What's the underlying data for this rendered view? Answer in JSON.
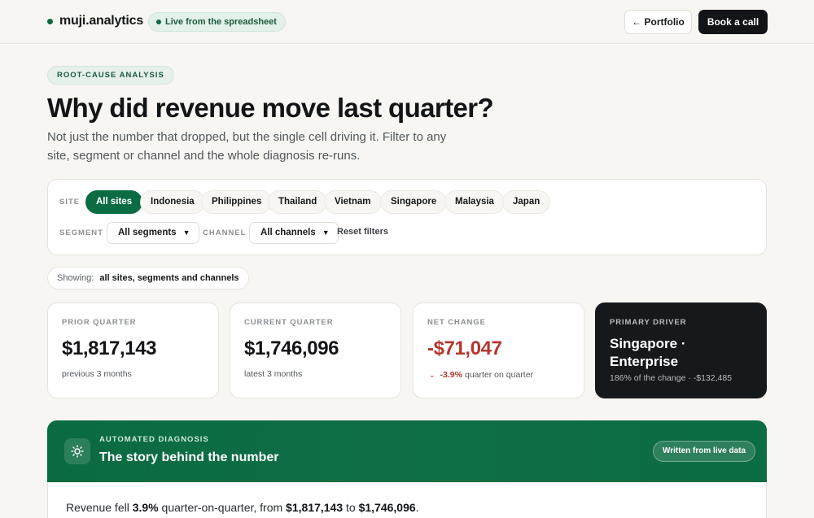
{
  "header": {
    "brand": "muji.analytics",
    "live_badge": "Live from the spreadsheet",
    "portfolio_button": "← Portfolio",
    "call_button": "Book a call"
  },
  "hero": {
    "eyebrow": "ROOT-CAUSE ANALYSIS",
    "title": "Why did revenue move last quarter?",
    "subtitle": "Not just the number that dropped, but the single cell driving it. Filter to any site, segment or channel and the whole diagnosis re-runs."
  },
  "filters": {
    "site_label": "SITE",
    "sites": [
      "All sites",
      "Indonesia",
      "Philippines",
      "Thailand",
      "Vietnam",
      "Singapore",
      "Malaysia",
      "Japan"
    ],
    "active_site": "All sites",
    "segment_label": "SEGMENT",
    "segment_value": "All segments",
    "channel_label": "CHANNEL",
    "channel_value": "All channels",
    "reset_label": "Reset filters"
  },
  "showing": {
    "label": "Showing:",
    "value": "all sites, segments and channels"
  },
  "metrics": {
    "prior": {
      "label": "PRIOR QUARTER",
      "value": "$1,817,143",
      "sub": "previous 3 months"
    },
    "current": {
      "label": "CURRENT QUARTER",
      "value": "$1,746,096",
      "sub": "latest 3 months"
    },
    "net": {
      "label": "NET CHANGE",
      "value": "-$71,047",
      "pct": "-3.9%",
      "sub": "quarter on quarter"
    },
    "driver": {
      "label": "PRIMARY DRIVER",
      "title": "Singapore · Enterprise",
      "sub": "186% of the change · -$132,485"
    }
  },
  "diagnosis": {
    "eyebrow": "AUTOMATED DIAGNOSIS",
    "title": "The story behind the number",
    "badge": "Written from live data",
    "text_1": "Revenue fell ",
    "text_pct": "3.9%",
    "text_2": " quarter-on-quarter, from ",
    "text_from": "$1,817,143",
    "text_3": " to ",
    "text_to": "$1,746,096",
    "text_4": "."
  },
  "colors": {
    "accent": "#0b6b43",
    "negative": "#b3372f",
    "dark_card": "#16191c"
  }
}
